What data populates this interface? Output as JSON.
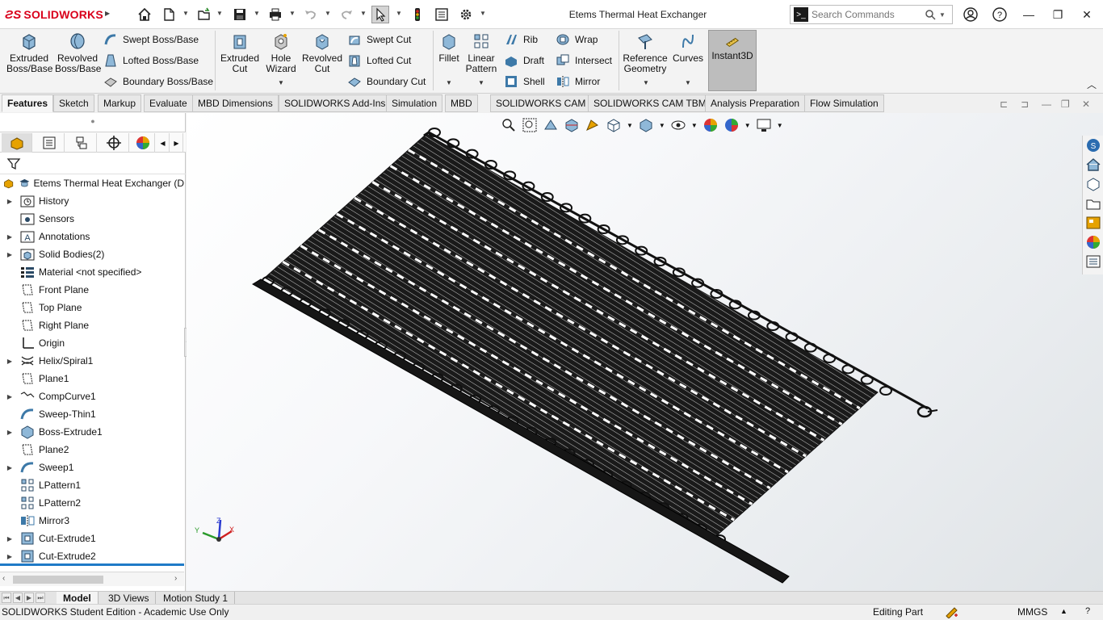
{
  "app": {
    "brand": "SOLIDWORKS",
    "document_title": "Etems Thermal Heat Exchanger"
  },
  "search": {
    "placeholder": "Search Commands"
  },
  "ribbon": {
    "extruded_boss": "Extruded Boss/Base",
    "revolved_boss": "Revolved Boss/Base",
    "swept_boss": "Swept Boss/Base",
    "lofted_boss": "Lofted Boss/Base",
    "boundary_boss": "Boundary Boss/Base",
    "extruded_cut": "Extruded Cut",
    "hole_wizard": "Hole Wizard",
    "revolved_cut": "Revolved Cut",
    "swept_cut": "Swept Cut",
    "lofted_cut": "Lofted Cut",
    "boundary_cut": "Boundary Cut",
    "fillet": "Fillet",
    "linear_pattern": "Linear Pattern",
    "rib": "Rib",
    "draft": "Draft",
    "shell": "Shell",
    "wrap": "Wrap",
    "intersect": "Intersect",
    "mirror": "Mirror",
    "reference_geometry": "Reference Geometry",
    "curves": "Curves",
    "instant3d": "Instant3D"
  },
  "tabs": [
    "Features",
    "Sketch",
    "Markup",
    "Evaluate",
    "MBD Dimensions",
    "SOLIDWORKS Add-Ins",
    "Simulation",
    "MBD",
    "SOLIDWORKS CAM",
    "SOLIDWORKS CAM TBM",
    "Analysis Preparation",
    "Flow Simulation"
  ],
  "tree": {
    "root": "Etems Thermal Heat Exchanger (D",
    "items": [
      "History",
      "Sensors",
      "Annotations",
      "Solid Bodies(2)",
      "Material <not specified>",
      "Front Plane",
      "Top Plane",
      "Right Plane",
      "Origin",
      "Helix/Spiral1",
      "Plane1",
      "CompCurve1",
      "Sweep-Thin1",
      "Boss-Extrude1",
      "Plane2",
      "Sweep1",
      "LPattern1",
      "LPattern2",
      "Mirror3",
      "Cut-Extrude1",
      "Cut-Extrude2"
    ]
  },
  "triad": {
    "x": "X",
    "y": "Y",
    "z": "Z"
  },
  "bottom_tabs": [
    "Model",
    "3D Views",
    "Motion Study 1"
  ],
  "status": {
    "edition": "SOLIDWORKS Student Edition - Academic Use Only",
    "mode": "Editing Part",
    "units": "MMGS"
  }
}
